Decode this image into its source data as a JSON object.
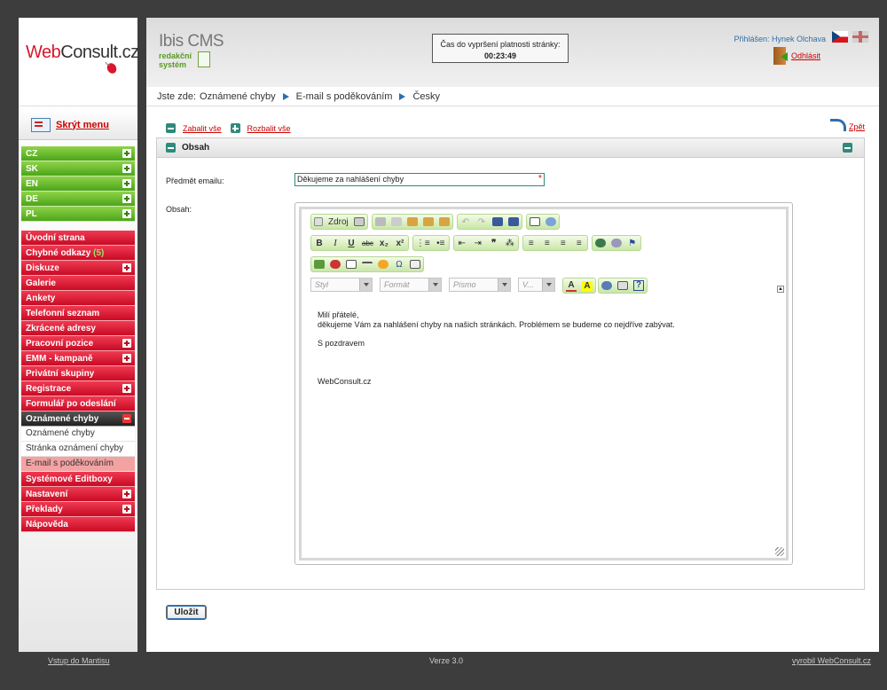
{
  "logo": {
    "web": "Web",
    "consult": "Consult.cz"
  },
  "left": {
    "hide_menu": "Skrýt menu",
    "lang_items": [
      {
        "label": "CZ"
      },
      {
        "label": "SK"
      },
      {
        "label": "EN"
      },
      {
        "label": "DE"
      },
      {
        "label": "PL"
      }
    ],
    "menu": {
      "uvodni": "Úvodní strana",
      "chybne": "Chybné odkazy",
      "chybne_count": "(5)",
      "diskuze": "Diskuze",
      "galerie": "Galerie",
      "ankety": "Ankety",
      "telefon": "Telefonní seznam",
      "zkracene": "Zkrácené adresy",
      "pracovni": "Pracovní pozice",
      "emm": "EMM - kampaně",
      "privatni": "Privátní skupiny",
      "registrace": "Registrace",
      "formular": "Formulář po odeslání",
      "oznamene": "Oznámené chyby",
      "sub1": "Oznámené chyby",
      "sub2": "Stránka oznámení chyby",
      "sub3": "E-mail s poděkováním",
      "systemove": "Systémové Editboxy",
      "nastaveni": "Nastavení",
      "preklady": "Překlady",
      "napoveda": "Nápověda"
    }
  },
  "header": {
    "cms_title": "Ibis CMS",
    "cms_sub1": "redakční",
    "cms_sub2": "systém",
    "timer_label": "Čas do vypršení platnosti stránky:",
    "timer_value": "00:23:49",
    "logged_in": "Přihlášen: Hynek Olchava",
    "logout": "Odhlásit"
  },
  "breadcrumb": {
    "prefix": "Jste zde:",
    "c1": "Oznámené chyby",
    "c2": "E-mail s poděkováním",
    "c3": "Česky"
  },
  "toolbar": {
    "collapse_all": "Zabalit vše",
    "expand_all": "Rozbalit vše",
    "back": "Zpět"
  },
  "panel": {
    "title": "Obsah",
    "subject_label": "Předmět emailu:",
    "subject_value": "Děkujeme za nahlášení chyby",
    "required_mark": "*",
    "content_label": "Obsah:"
  },
  "editor": {
    "source": "Zdroj",
    "style": "Styl",
    "format": "Formát",
    "font": "Písmo",
    "size": "V...",
    "line1": "Milí přátelé,",
    "line2": "děkujeme Vám za nahlášení chyby na našich stránkách. Problémem se budeme co nejdříve zabývat.",
    "line3": "S pozdravem",
    "line4": "WebConsult.cz"
  },
  "save_label": "Uložit",
  "footer": {
    "left": "Vstup do Mantisu",
    "version": "Verze 3.0",
    "right": "vyrobil WebConsult.cz"
  },
  "colors": {
    "green": "#4ca51a",
    "red": "#c90b24",
    "blue": "#2e6fae",
    "teal": "#2f8a7a"
  }
}
